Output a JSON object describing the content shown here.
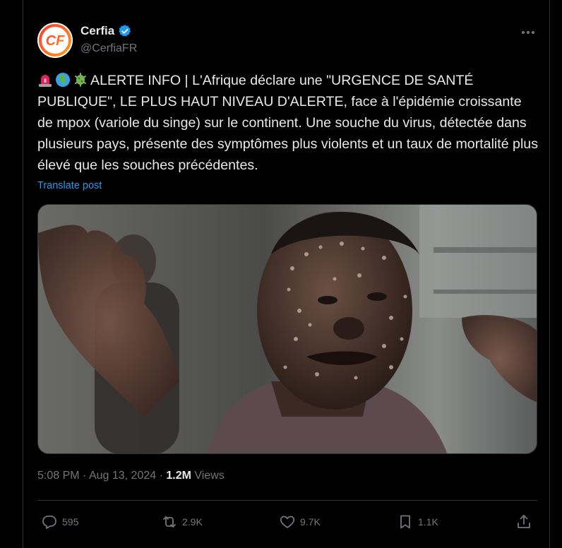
{
  "author": {
    "name": "Cerfia",
    "handle": "@CerfiaFR",
    "avatar_initials": "CF",
    "verified": true
  },
  "tweet": {
    "text": "ALERTE INFO | L'Afrique déclare une \"URGENCE DE SANTÉ PUBLIQUE\", LE PLUS HAUT NIVEAU D'ALERTE, face à l'épidémie croissante de mpox (variole du singe) sur le continent. Une souche du virus, détectée dans plusieurs pays, présente des symptômes plus violents et un taux de mortalité plus élevé que les souches précédentes.",
    "leading_emojis": [
      "rotating-light-icon",
      "globe-africa-icon",
      "microbe-icon"
    ],
    "translate_label": "Translate post"
  },
  "meta": {
    "time": "5:08 PM",
    "sep1": "·",
    "date": "Aug 13, 2024",
    "sep2": "·",
    "views_count": "1.2M",
    "views_label": "Views"
  },
  "actions": {
    "replies": "595",
    "reposts": "2.9K",
    "likes": "9.7K",
    "bookmarks": "1.1K"
  },
  "colors": {
    "background": "#000000",
    "text": "#e7e9ea",
    "secondary": "#71767b",
    "accent": "#1d9bf0",
    "border": "#2f3336"
  }
}
